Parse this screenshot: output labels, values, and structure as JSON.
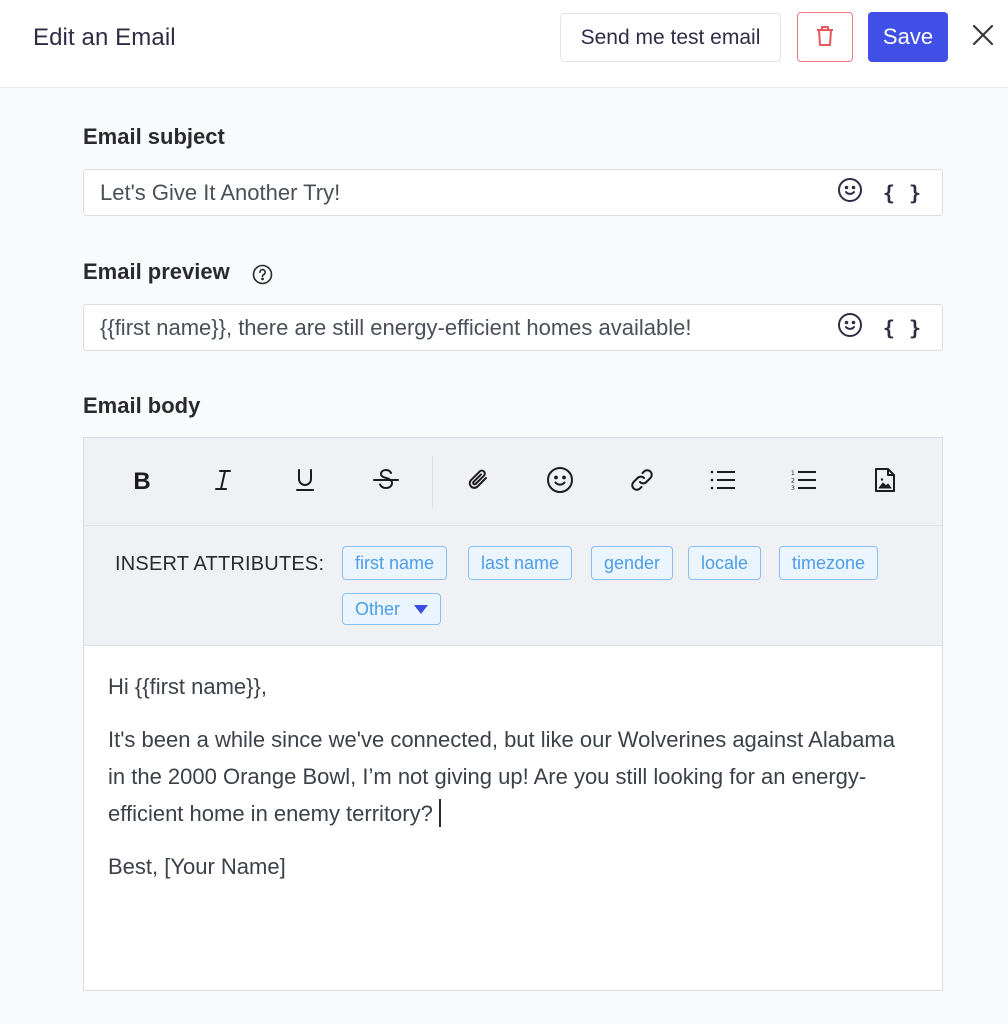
{
  "header": {
    "title": "Edit an Email",
    "send_test_label": "Send me test email",
    "save_label": "Save",
    "delete_icon": "trash-icon",
    "close_icon": "close-icon"
  },
  "subject": {
    "label": "Email subject",
    "value": "Let's Give It Another Try!",
    "icons": [
      "emoji-icon",
      "curly-braces-icon"
    ],
    "curly_text": "{ }"
  },
  "preview": {
    "label": "Email preview",
    "help_icon": "help-icon",
    "value": "{{first name}}, there are still energy-efficient homes available!",
    "icons": [
      "emoji-icon",
      "curly-braces-icon"
    ],
    "curly_text": "{ }"
  },
  "body": {
    "label": "Email body",
    "toolbar": {
      "bold": "B",
      "italic": "I",
      "underline": "U",
      "strikethrough": "S",
      "tools": [
        "attachment-icon",
        "emoji-icon",
        "link-icon",
        "bullet-list-icon",
        "numbered-list-icon",
        "image-file-icon"
      ]
    },
    "attributes": {
      "label": "INSERT ATTRIBUTES:",
      "chips": [
        "first name",
        "last name",
        "gender",
        "locale",
        "timezone"
      ],
      "other_label": "Other"
    },
    "content": {
      "greeting": "Hi {{first name}},",
      "paragraph": "It's been a while since we've connected, but like our Wolverines against Alabama in the 2000 Orange Bowl, I’m not giving up! Are you still looking for an energy-efficient home in enemy territory?",
      "signoff": "Best, [Your Name]"
    }
  },
  "colors": {
    "primary": "#4050e6",
    "danger": "#ea7a80",
    "chip_text": "#4d9de6",
    "chip_bg": "#ebf5ff"
  }
}
